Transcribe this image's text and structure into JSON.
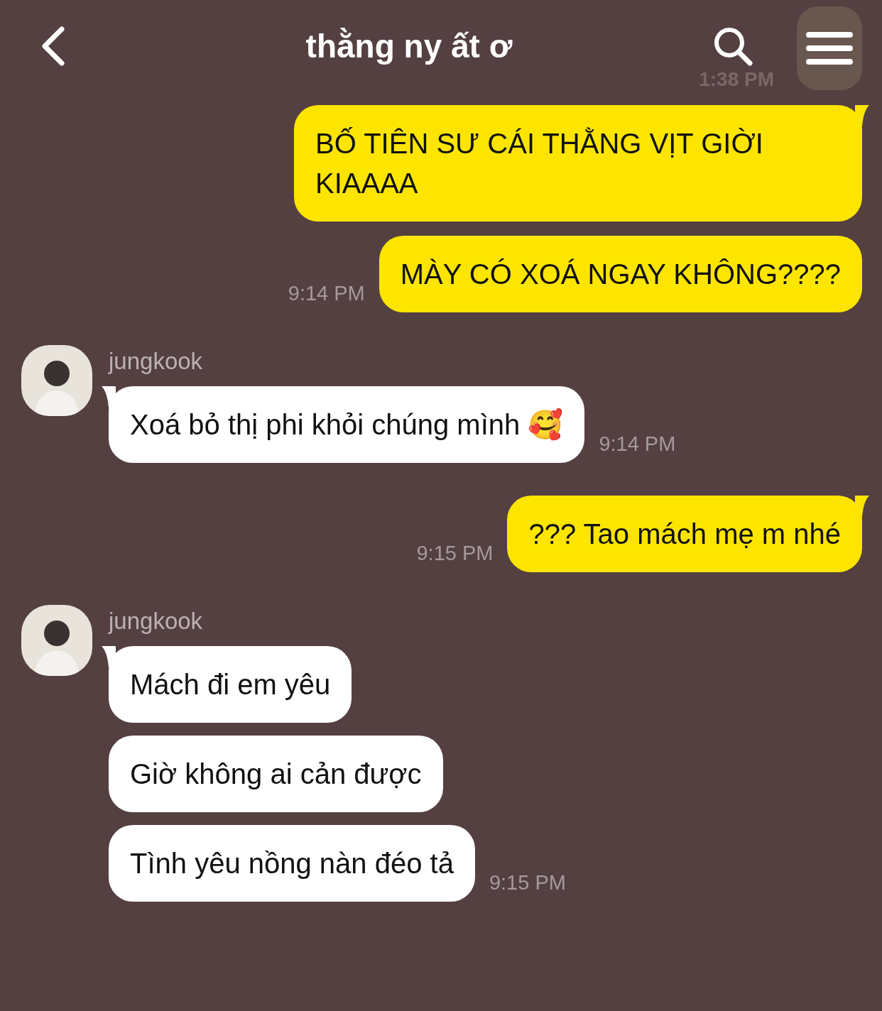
{
  "header": {
    "title": "thằng ny ất ơ",
    "faded_time": "1:38 PM"
  },
  "groups": [
    {
      "kind": "sent",
      "bubbles": [
        "BỐ TIÊN SƯ CÁI THẰNG VỊT GIỜI KIAAAA",
        "MÀY CÓ XOÁ NGAY KHÔNG????"
      ],
      "time": "9:14 PM"
    },
    {
      "kind": "received",
      "sender": "jungkook",
      "bubbles": [
        "Xoá bỏ thị phi khỏi chúng mình 🥰"
      ],
      "time": "9:14 PM"
    },
    {
      "kind": "sent",
      "bubbles": [
        "??? Tao mách mẹ m nhé"
      ],
      "time": "9:15 PM"
    },
    {
      "kind": "received",
      "sender": "jungkook",
      "bubbles": [
        "Mách đi em yêu",
        "Giờ không ai cản được",
        "Tình yêu nồng nàn đéo tả"
      ],
      "time": "9:15 PM"
    }
  ]
}
